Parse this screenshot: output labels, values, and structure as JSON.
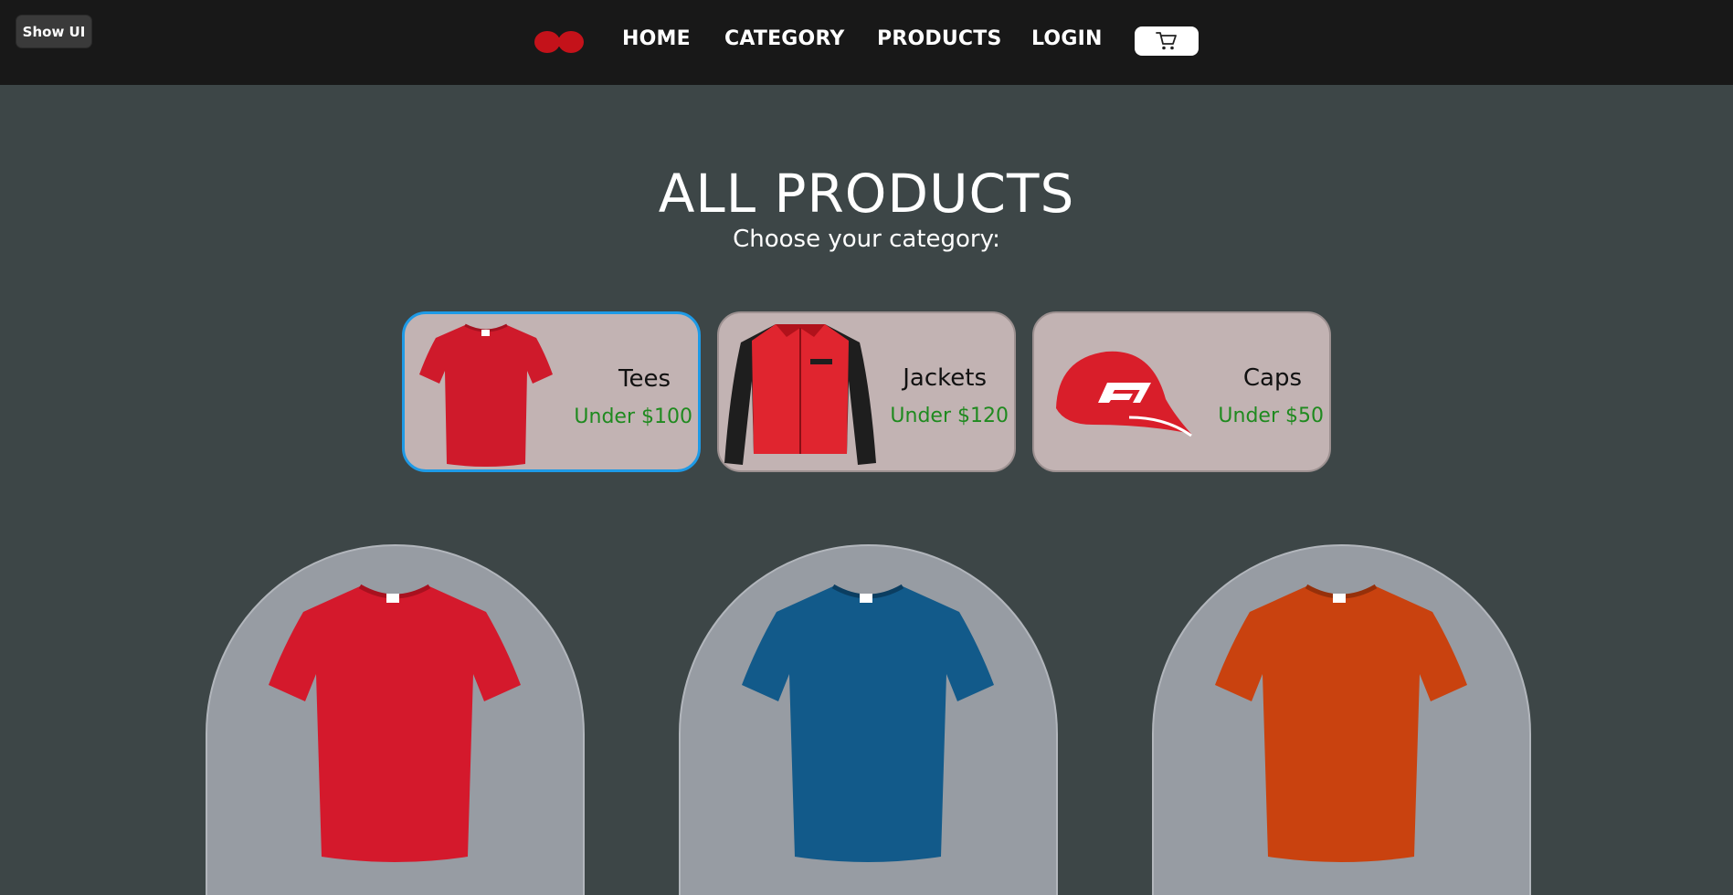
{
  "app": {
    "show_ui_label": "Show UI"
  },
  "nav": {
    "items": [
      {
        "label": "HOME"
      },
      {
        "label": "CATEGORY"
      },
      {
        "label": "PRODUCTS"
      },
      {
        "label": "LOGIN"
      }
    ],
    "cart_icon": "cart-icon",
    "logo_icon": "brand-logo"
  },
  "main": {
    "title": "ALL PRODUCTS",
    "subtitle": "Choose your category:"
  },
  "categories": [
    {
      "name": "Tees",
      "price": "Under $100",
      "icon": "tshirt-image",
      "selected": true
    },
    {
      "name": "Jackets",
      "price": "Under $120",
      "icon": "jacket-image",
      "selected": false
    },
    {
      "name": "Caps",
      "price": "Under $50",
      "icon": "cap-image",
      "selected": false
    }
  ],
  "products": [
    {
      "label": "",
      "color": "#d4192c"
    },
    {
      "label": "",
      "color": "#125a8a"
    },
    {
      "label": "",
      "color": "#c9420f"
    }
  ],
  "colors": {
    "topbar": "#181818",
    "background": "#3d4647",
    "accent_selected": "#1e9ae6",
    "price_green": "#1f8a1f",
    "brand_red": "#c4121a"
  }
}
